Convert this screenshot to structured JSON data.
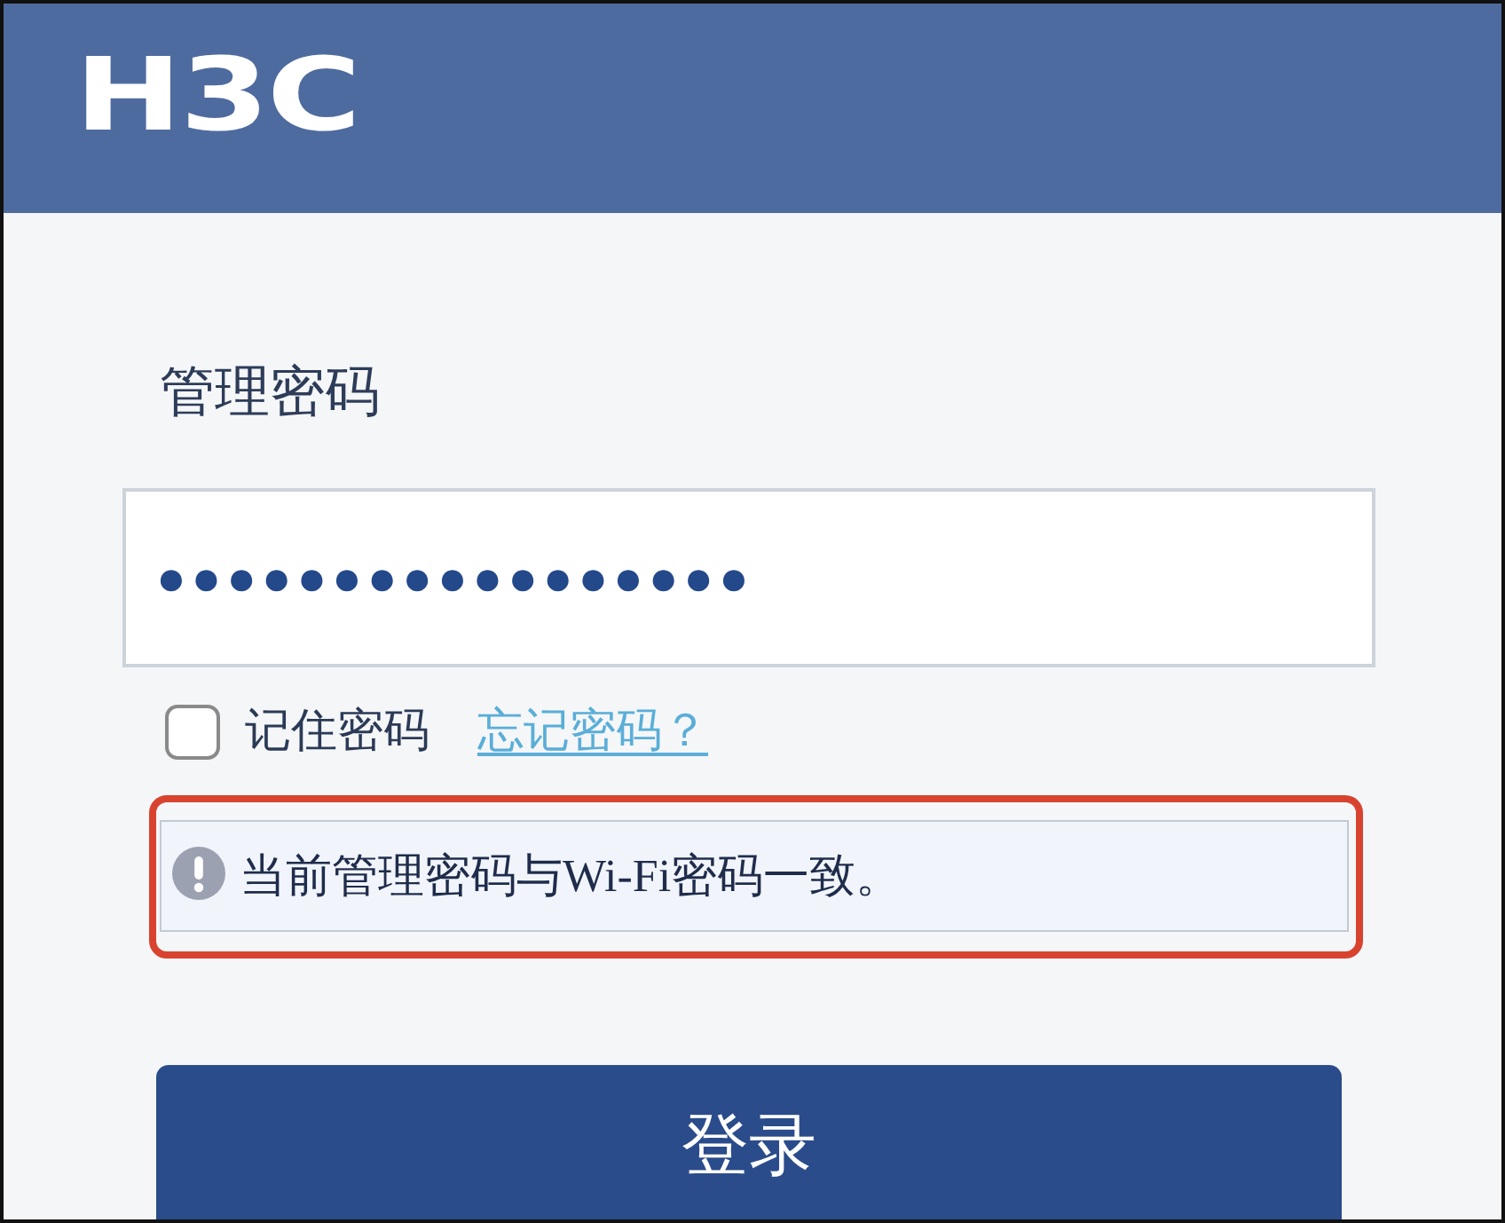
{
  "header": {
    "logo": "H3C"
  },
  "login_form": {
    "password_label": "管理密码",
    "password_field": {
      "value": "●●●●●●●●●●●●●●●●●"
    },
    "remember_password": {
      "label": "记住密码",
      "checked": false
    },
    "forgot_password_link": "忘记密码？",
    "notice": {
      "text": "当前管理密码与Wi-Fi密码一致。",
      "highlighted": true
    },
    "login_button": "登录"
  }
}
